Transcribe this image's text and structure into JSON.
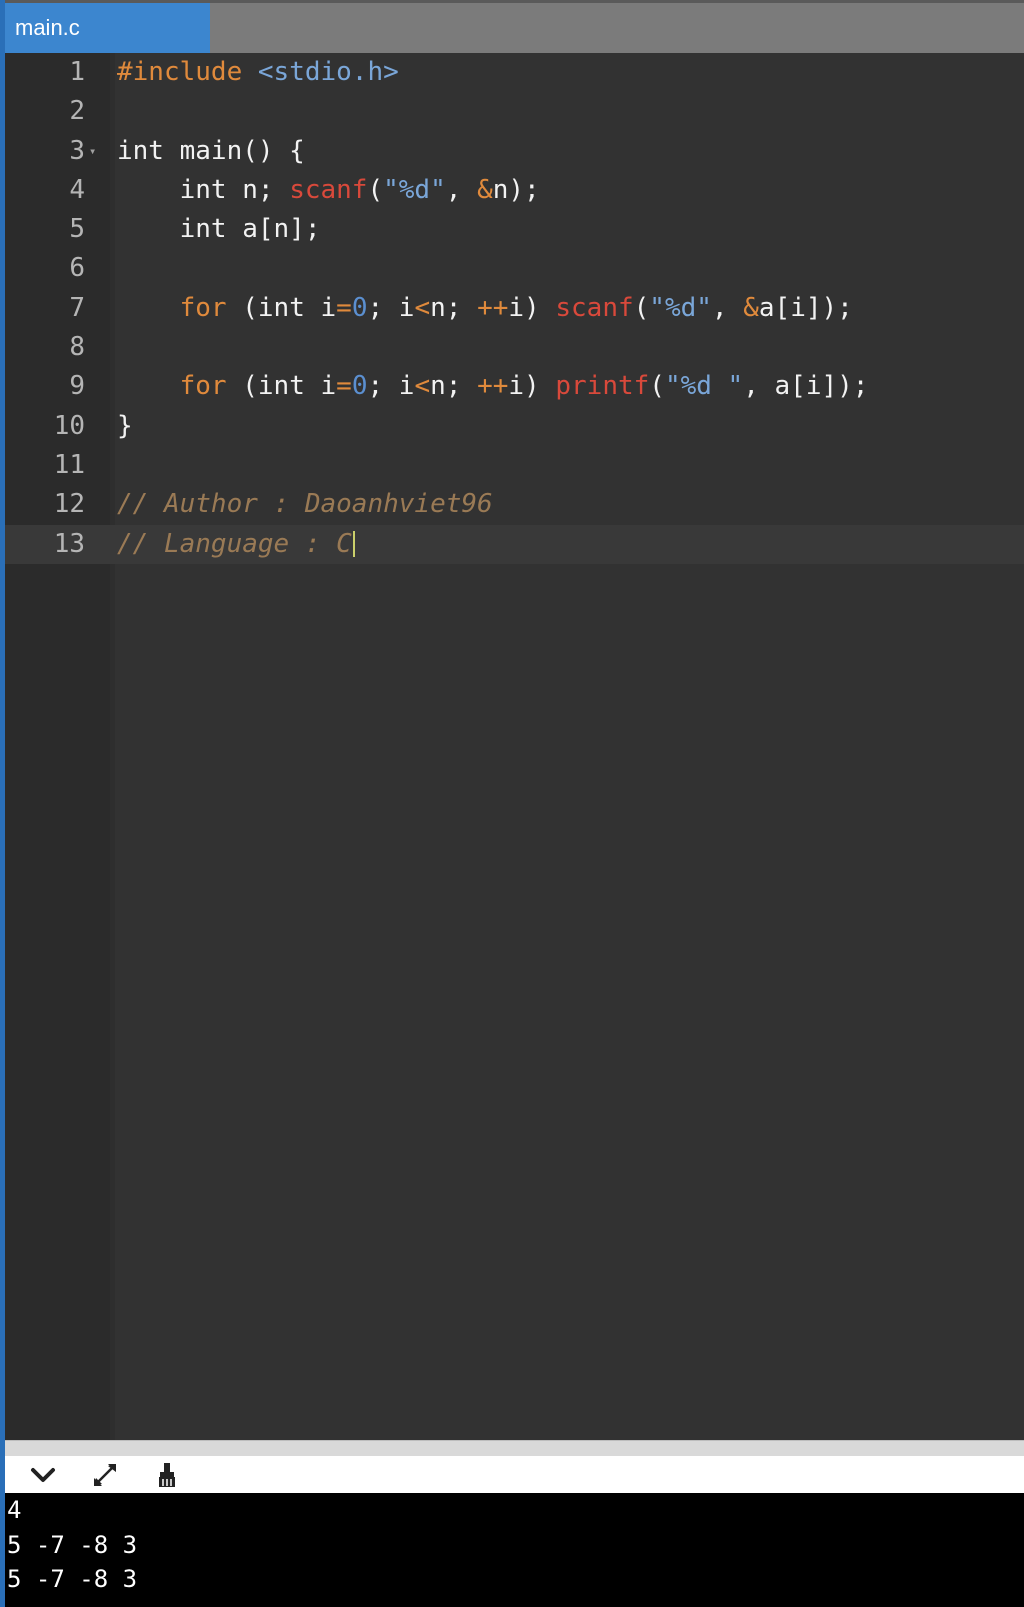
{
  "tab": {
    "label": "main.c"
  },
  "editor": {
    "lines": [
      {
        "n": "1"
      },
      {
        "n": "2"
      },
      {
        "n": "3"
      },
      {
        "n": "4"
      },
      {
        "n": "5"
      },
      {
        "n": "6"
      },
      {
        "n": "7"
      },
      {
        "n": "8"
      },
      {
        "n": "9"
      },
      {
        "n": "10"
      },
      {
        "n": "11"
      },
      {
        "n": "12"
      },
      {
        "n": "13"
      }
    ],
    "active_line": 13,
    "comment_author": "// Author : Daoanhviet96",
    "comment_language": "// Language : C"
  },
  "toolbar_icons": [
    "chevron-down-icon",
    "expand-icon",
    "clear-console-icon"
  ],
  "console": {
    "lines": [
      "4",
      "5 -7 -8 3",
      "5 -7 -8 3"
    ]
  },
  "colors": {
    "tab_active": "#3c86cf",
    "editor_bg": "#323232",
    "keyword": "#e08a3c",
    "function": "#d9493b",
    "string": "#7aa6d8",
    "comment": "#9a7a55"
  }
}
